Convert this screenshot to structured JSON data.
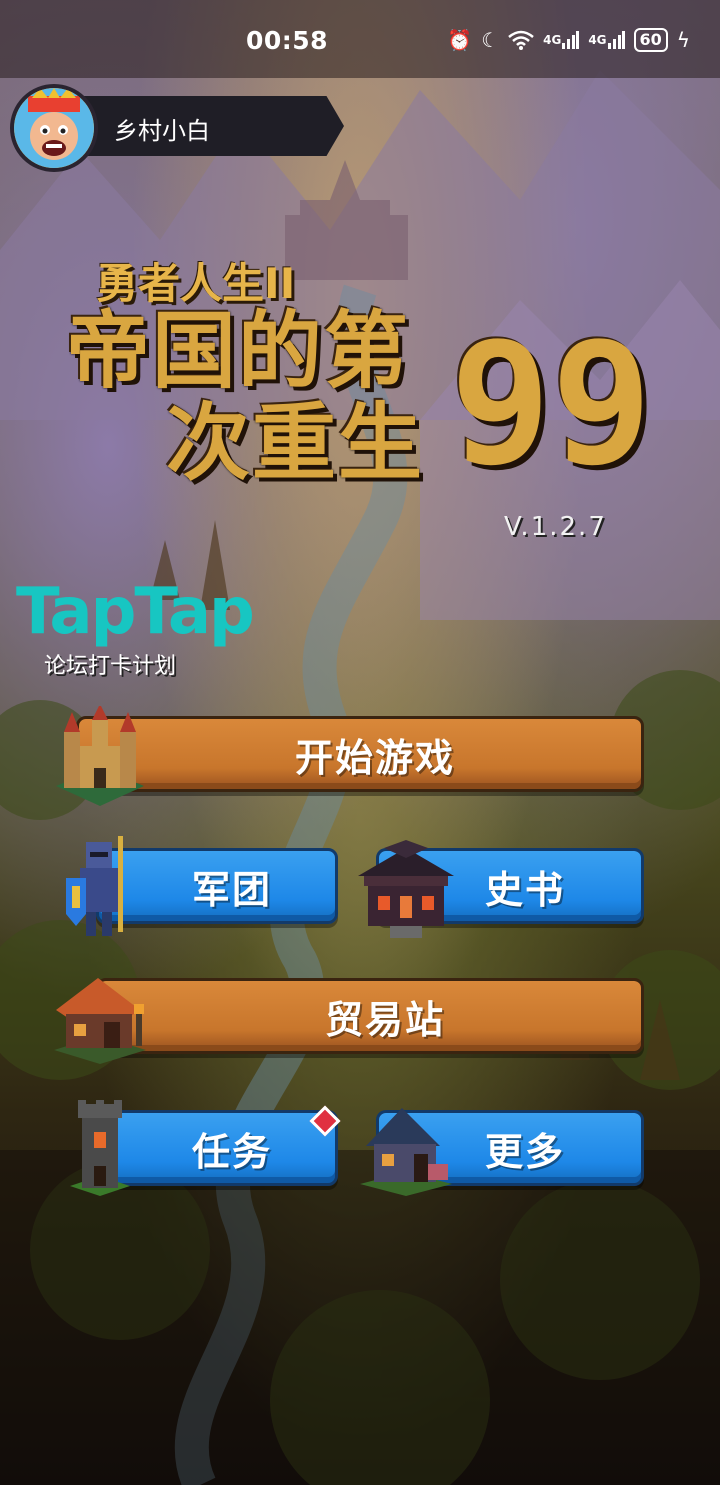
{
  "status_bar": {
    "time": "00:58",
    "signal1": "4G",
    "signal2": "4G",
    "battery": "60"
  },
  "user": {
    "name": "乡村小白"
  },
  "title": {
    "subtitle": "勇者人生II",
    "main": "帝国的第​99​次重生",
    "main_line1": "帝国的第",
    "main_line2": "次重生",
    "number": "99",
    "version": "V.1.2.7"
  },
  "taptap": {
    "logo": "TapTap",
    "caption": "论坛打卡计划"
  },
  "menu": {
    "start_game": "开始游戏",
    "legion": "军团",
    "history_book": "史书",
    "trading_post": "贸易站",
    "quests": "任务",
    "more": "更多"
  },
  "colors": {
    "orange_button": "#c8762c",
    "blue_button": "#1e88e8",
    "title_gold": "#d9a640",
    "taptap_teal": "#17c6c2",
    "badge_red": "#e03040"
  },
  "icons": {
    "castle": "castle-icon",
    "knight": "knight-icon",
    "temple": "temple-icon",
    "market": "market-hut-icon",
    "tower": "tower-icon",
    "house": "house-icon"
  }
}
